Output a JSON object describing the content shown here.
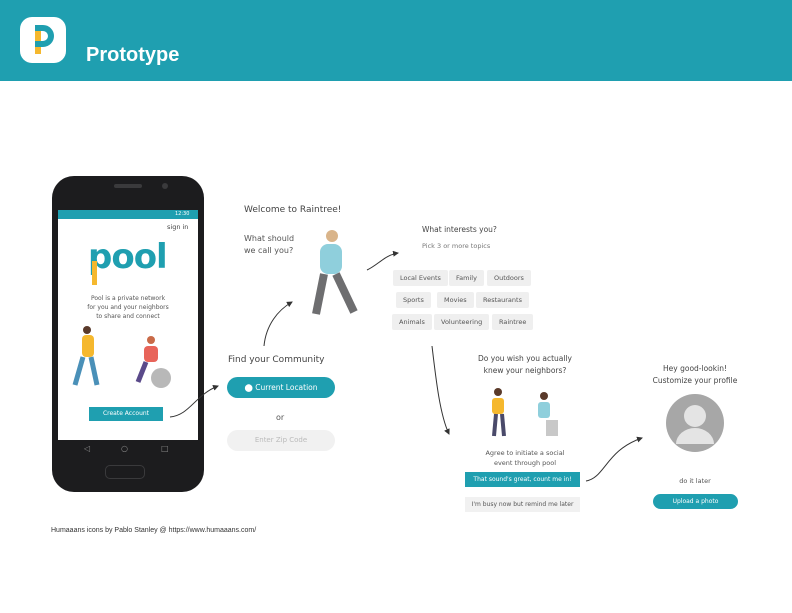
{
  "header": {
    "title": "Prototype"
  },
  "phone": {
    "status_time": "12:30",
    "sign_in": "sign in",
    "brand": "pool",
    "tagline": [
      "Pool is a private network",
      "for you and your neighbors",
      "to share and connect"
    ],
    "create_account": "Create Account"
  },
  "welcome": {
    "title": "Welcome to Raintree!",
    "question": [
      "What should",
      "we call you?"
    ]
  },
  "interests": {
    "title": "What interests you?",
    "subtitle": "Pick 3 or more topics",
    "chips": [
      "Local Events",
      "Family",
      "Outdoors",
      "Sports",
      "Movies",
      "Restaurants",
      "Animals",
      "Volunteering",
      "Raintree"
    ]
  },
  "community": {
    "title": "Find your Community",
    "current_location": "Current Location",
    "or": "or",
    "zip_placeholder": "Enter Zip Code"
  },
  "neighbors": {
    "title": [
      "Do you wish you actually",
      "knew your neighbors?"
    ],
    "agree": [
      "Agree to initiate a social",
      "event through pool"
    ],
    "accept": "That sound's great, count me in!",
    "later": "I'm busy now but remind me later"
  },
  "profile": {
    "title": [
      "Hey good-lookin!",
      "Customize your profile"
    ],
    "do_later": "do it later",
    "upload": "Upload a photo"
  },
  "credit": "Humaaans icons by Pablo Stanley @ https://www.humaaans.com/",
  "colors": {
    "teal": "#1f9fb0",
    "yellow": "#f5b82e",
    "chip_bg": "#efefef"
  }
}
